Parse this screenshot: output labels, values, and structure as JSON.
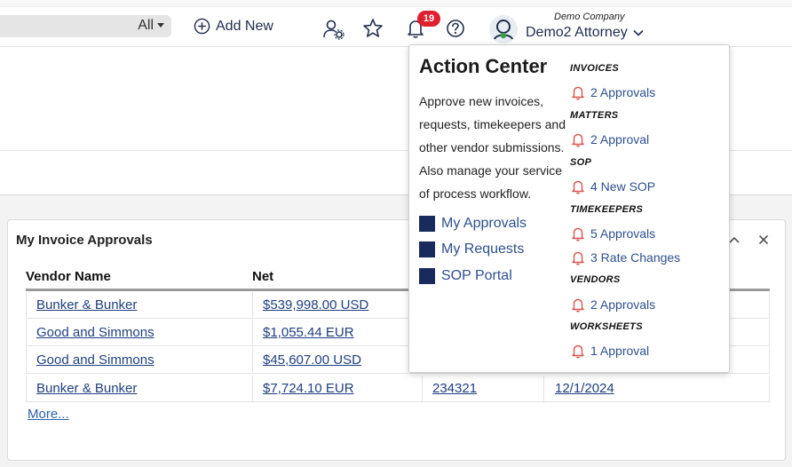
{
  "topbar": {
    "search_filter": "All",
    "add_new_label": "Add New",
    "notification_count": "19",
    "company": "Demo Company",
    "user": "Demo2 Attorney"
  },
  "widget": {
    "title": "My Invoice Approvals",
    "columns": [
      "Vendor Name",
      "Net"
    ],
    "rows": [
      {
        "vendor": "Bunker & Bunker",
        "net": "$539,998.00 USD",
        "c3": "",
        "c4": ""
      },
      {
        "vendor": "Good and Simmons",
        "net": "$1,055.44 EUR",
        "c3": "",
        "c4": ""
      },
      {
        "vendor": "Good and Simmons",
        "net": "$45,607.00 USD",
        "c3": "",
        "c4": ""
      },
      {
        "vendor": "Bunker & Bunker",
        "net": "$7,724.10 EUR",
        "c3": "234321",
        "c4": "12/1/2024"
      }
    ],
    "more_label": "More..."
  },
  "action_center": {
    "title": "Action Center",
    "description": "Approve new invoices, requests, timekeepers and other vendor submissions. Also manage your service of process workflow.",
    "links": [
      "My Approvals",
      "My Requests",
      "SOP Portal"
    ],
    "sections": [
      {
        "heading": "INVOICES",
        "items": [
          "2 Approvals"
        ]
      },
      {
        "heading": "MATTERS",
        "items": [
          "2 Approval"
        ]
      },
      {
        "heading": "SOP",
        "items": [
          "4 New SOP"
        ]
      },
      {
        "heading": "TIMEKEEPERS",
        "items": [
          "5 Approvals",
          "3 Rate Changes"
        ]
      },
      {
        "heading": "VENDORS",
        "items": [
          "2 Approvals"
        ]
      },
      {
        "heading": "WORKSHEETS",
        "items": [
          "1 Approval"
        ]
      }
    ]
  },
  "colors": {
    "accent_navy": "#1a2a5c",
    "link_blue": "#2e4f8f",
    "badge_red": "#e0202e",
    "bell_red": "#d9534f"
  }
}
